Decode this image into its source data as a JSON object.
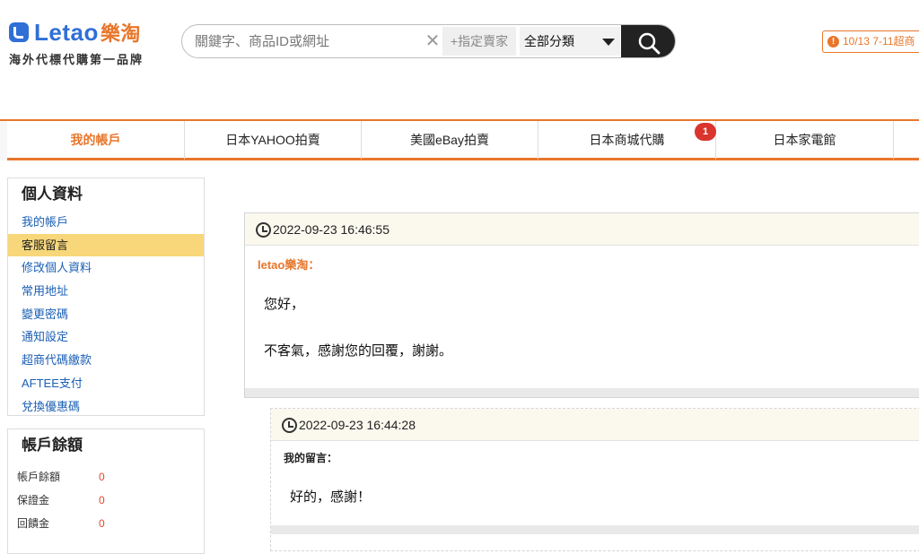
{
  "brand": {
    "logo_word": "Letao",
    "logo_cn": "樂淘",
    "slogan": "海外代標代購第一品牌"
  },
  "search": {
    "placeholder": "關鍵字、商品ID或網址",
    "clear_icon": "close-icon",
    "seller_label": "+指定賣家",
    "category_selected": "全部分類",
    "button_icon": "search-icon"
  },
  "notice": {
    "text": "10/13 7-11超商",
    "icon": "info-icon",
    "color": "#e8762b"
  },
  "nav": {
    "tabs": [
      {
        "label": "我的帳戶"
      },
      {
        "label": "日本YAHOO拍賣"
      },
      {
        "label": "美國eBay拍賣"
      },
      {
        "label": "日本商城代購",
        "badge": "1"
      },
      {
        "label": "日本家電館"
      }
    ]
  },
  "sidebar": {
    "profile": {
      "title": "個人資料",
      "items": [
        {
          "label": "我的帳戶"
        },
        {
          "label": "客服留言"
        },
        {
          "label": "修改個人資料"
        },
        {
          "label": "常用地址"
        },
        {
          "label": "變更密碼"
        },
        {
          "label": "通知設定"
        },
        {
          "label": "超商代碼繳款"
        },
        {
          "label": "AFTEE支付"
        },
        {
          "label": "兌換優惠碼"
        }
      ]
    },
    "balance": {
      "title": "帳戶餘額",
      "rows": [
        {
          "label": "帳戶餘額",
          "value": "0"
        },
        {
          "label": "保證金",
          "value": "0"
        },
        {
          "label": "回饋金",
          "value": "0"
        }
      ]
    }
  },
  "messages": [
    {
      "time": "2022-09-23 16:46:55",
      "author": "letao樂淘：",
      "lines": [
        "您好，",
        "不客氣，感謝您的回覆，謝謝。"
      ]
    },
    {
      "time": "2022-09-23 16:44:28",
      "author": "我的留言：",
      "lines": [
        "好的，感謝！"
      ]
    }
  ],
  "colors": {
    "accent": "#e8762b",
    "brand_blue": "#2f6fd6",
    "highlight": "#f8d77a",
    "link": "#1a5fb4"
  }
}
